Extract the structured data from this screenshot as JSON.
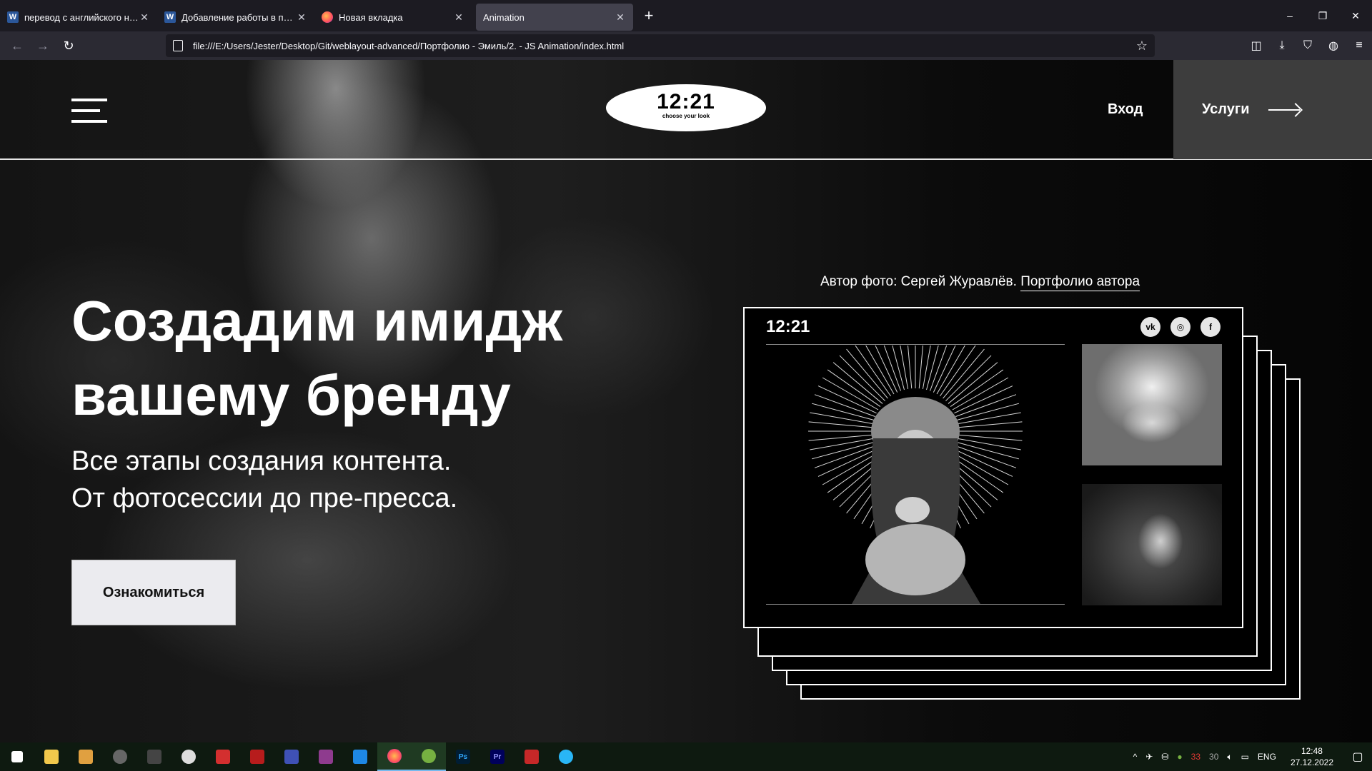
{
  "browser": {
    "tabs": [
      {
        "label": "перевод с английского на рус",
        "icon": "word-icon",
        "active": false
      },
      {
        "label": "Добавление работы в портфо",
        "icon": "word-icon",
        "active": false
      },
      {
        "label": "Новая вкладка",
        "icon": "firefox-icon",
        "active": false
      },
      {
        "label": "Animation",
        "icon": "none",
        "active": true
      }
    ],
    "new_tab": "+",
    "url": "file:///E:/Users/Jester/Desktop/Git/weblayout-advanced/Портфолио - Эмиль/2. - JS Animation/index.html",
    "window_controls": {
      "minimize": "–",
      "restore": "❐",
      "close": "✕"
    }
  },
  "site": {
    "logo": {
      "time": "12:21",
      "tagline": "choose your look"
    },
    "nav": {
      "login": "Вход",
      "services": "Услуги"
    },
    "hero": {
      "title": "Создадим имидж\nвашему бренду",
      "subtitle": "Все этапы создания контента.\nОт фотосессии до пре-пресса.",
      "cta": "Ознакомиться"
    },
    "credit": {
      "text": "Автор фото: Сергей Журавлёв.",
      "link": "Портфолио автора"
    },
    "card": {
      "logo": "12:21",
      "social": [
        {
          "icon": "vk-icon",
          "glyph": "vk"
        },
        {
          "icon": "instagram-icon",
          "glyph": "◎"
        },
        {
          "icon": "facebook-icon",
          "glyph": "f"
        }
      ]
    }
  },
  "taskbar": {
    "lang": "ENG",
    "time": "12:48",
    "date": "27.12.2022",
    "tray_numbers": [
      "33",
      "30"
    ]
  },
  "colors": {
    "chrome_dark": "#1c1b22",
    "chrome_toolbar": "#2b2a33",
    "services_bg": "#3d3d3d",
    "cta_bg": "#ebebef",
    "taskbar": "#0e1a10"
  }
}
